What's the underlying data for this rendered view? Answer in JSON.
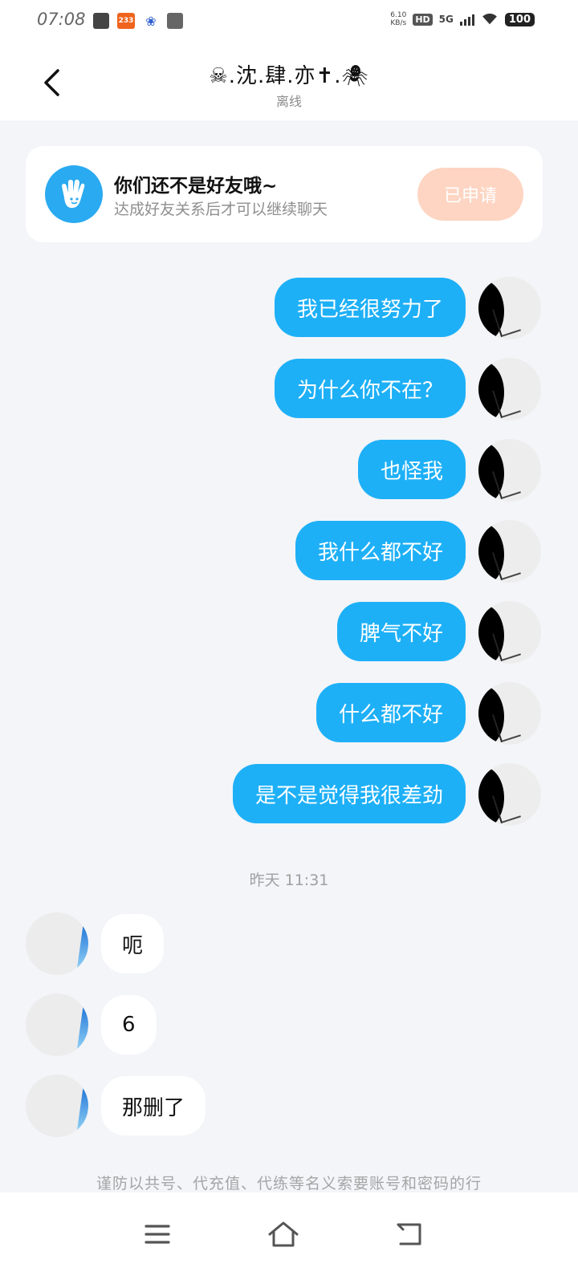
{
  "status_bar": {
    "time": "07:08",
    "app_badge": "233",
    "net_speed_value": "6.10",
    "net_speed_unit": "KB/s",
    "hd": "HD",
    "network": "5G",
    "battery": "100"
  },
  "header": {
    "title": "☠.沈.肆.亦✝.🕷",
    "status": "离线"
  },
  "friend_card": {
    "title": "你们还不是好友哦~",
    "subtitle": "达成好友关系后才可以继续聊天",
    "button": "已申请"
  },
  "messages_out": [
    "我已经很努力了",
    "为什么你不在？",
    "也怪我",
    "我什么都不好",
    "脾气不好",
    "什么都不好",
    "是不是觉得我很差劲"
  ],
  "timestamp": "昨天 11:31",
  "messages_in": [
    "呃",
    "6",
    "那删了"
  ],
  "notice": "谨防以共号、代充值、代练等名义索要账号和密码的行",
  "colors": {
    "bubble_out": "#1eb0f7",
    "bubble_in": "#ffffff",
    "background": "#f3f5f8",
    "request_button": "#fdd5c2",
    "card_icon": "#2aaaf0"
  },
  "icons": {
    "back": "chevron-left-icon",
    "card": "waving-hand-icon",
    "nav_menu": "menu-icon",
    "nav_home": "home-icon",
    "nav_back": "return-icon"
  }
}
